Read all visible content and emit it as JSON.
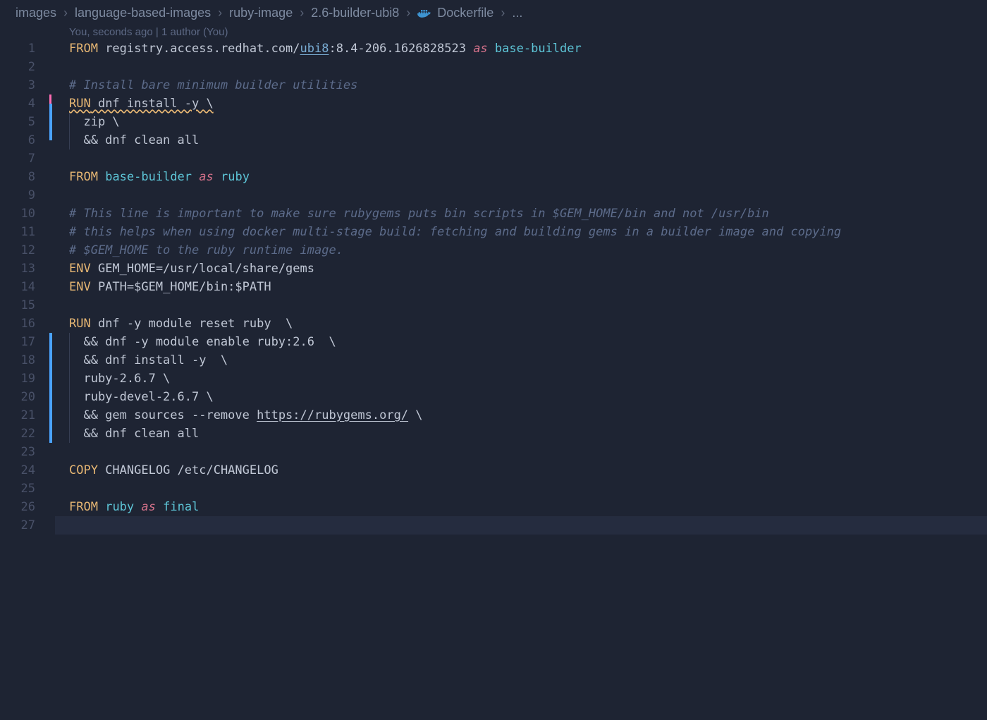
{
  "breadcrumb": {
    "items": [
      "images",
      "language-based-images",
      "ruby-image",
      "2.6-builder-ubi8",
      "Dockerfile",
      "..."
    ],
    "separator": "›"
  },
  "blame": "You, seconds ago | 1 author (You)",
  "line_numbers": [
    "1",
    "2",
    "3",
    "4",
    "5",
    "6",
    "7",
    "8",
    "9",
    "10",
    "11",
    "12",
    "13",
    "14",
    "15",
    "16",
    "17",
    "18",
    "19",
    "20",
    "21",
    "22",
    "23",
    "24",
    "25",
    "26",
    "27"
  ],
  "marks": [
    {
      "start": 3,
      "end": 3,
      "class": "pink"
    },
    {
      "start": 4,
      "end": 5,
      "class": ""
    },
    {
      "start": 16,
      "end": 21,
      "class": ""
    }
  ],
  "code": {
    "l1": {
      "kw": "FROM",
      "a": " registry.access.redhat.com/",
      "link": "ubi8",
      "b": ":8.4-206.1626828523 ",
      "as": "as",
      "c": " ",
      "alias": "base-builder"
    },
    "l3": "# Install bare minimum builder utilities",
    "l4": {
      "kw": "RUN",
      "rest": " dnf install -y \\"
    },
    "l5": {
      "guide": true,
      "text": "  zip \\"
    },
    "l6": {
      "guide": true,
      "text": "  && dnf clean all"
    },
    "l8": {
      "kw": "FROM",
      "a": " ",
      "alias1": "base-builder",
      "sp": " ",
      "as": "as",
      "sp2": " ",
      "alias2": "ruby"
    },
    "l10": "# This line is important to make sure rubygems puts bin scripts in $GEM_HOME/bin and not /usr/bin",
    "l11": "# this helps when using docker multi-stage build: fetching and building gems in a builder image and copying",
    "l12": "# $GEM_HOME to the ruby runtime image.",
    "l13": {
      "kw": "ENV",
      "rest": " GEM_HOME=/usr/local/share/gems"
    },
    "l14": {
      "kw": "ENV",
      "rest": " PATH=$GEM_HOME/bin:$PATH"
    },
    "l16": {
      "kw": "RUN",
      "rest": " dnf -y module reset ruby  \\"
    },
    "l17": {
      "guide": true,
      "text": "  && dnf -y module enable ruby:2.6  \\"
    },
    "l18": {
      "guide": true,
      "text": "  && dnf install -y  \\"
    },
    "l19": {
      "guide": true,
      "text": "  ruby-2.6.7 \\"
    },
    "l20": {
      "guide": true,
      "text": "  ruby-devel-2.6.7 \\"
    },
    "l21": {
      "guide": true,
      "a": "  && gem sources --remove ",
      "link": "https://rubygems.org/",
      "b": " \\"
    },
    "l22": {
      "guide": true,
      "text": "  && dnf clean all"
    },
    "l24": {
      "kw": "COPY",
      "rest": " CHANGELOG /etc/CHANGELOG"
    },
    "l26": {
      "kw": "FROM",
      "a": " ",
      "alias1": "ruby",
      "sp": " ",
      "as": "as",
      "sp2": " ",
      "alias2": "final"
    }
  },
  "colors": {
    "background": "#1e2433",
    "keyword": "#e6b673",
    "alias": "#5dc4d6",
    "as": "#d4718a",
    "comment": "#5c6b8a",
    "link": "#7aaed6",
    "gutter": "#495168",
    "current_line": "#252c3f"
  }
}
